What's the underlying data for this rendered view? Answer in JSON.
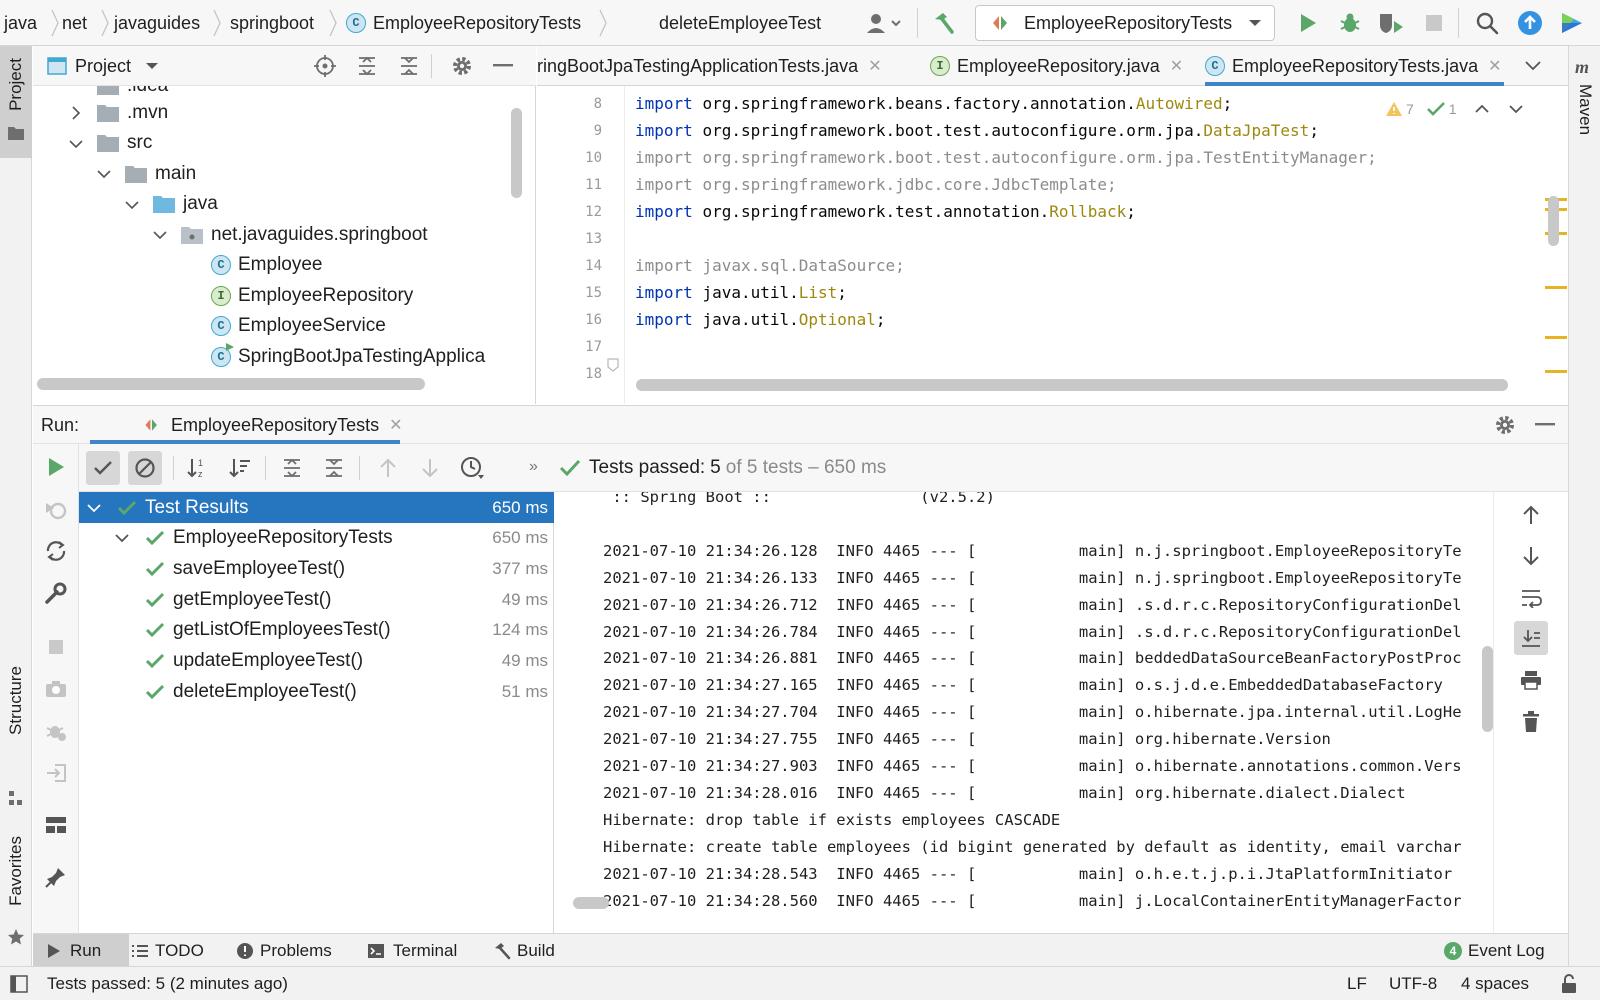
{
  "breadcrumbs": [
    "java",
    "net",
    "javaguides",
    "springboot",
    "EmployeeRepositoryTests",
    "deleteEmployeeTest"
  ],
  "run_config": "EmployeeRepositoryTests",
  "project_panel": {
    "title": "Project",
    "tree": [
      {
        "label": ".idea",
        "kind": "folder"
      },
      {
        "label": ".mvn",
        "kind": "folder"
      },
      {
        "label": "src",
        "kind": "folder"
      },
      {
        "label": "main",
        "kind": "folder"
      },
      {
        "label": "java",
        "kind": "source-folder"
      },
      {
        "label": "net.javaguides.springboot",
        "kind": "package"
      },
      {
        "label": "Employee",
        "kind": "class"
      },
      {
        "label": "EmployeeRepository",
        "kind": "interface"
      },
      {
        "label": "EmployeeService",
        "kind": "class"
      },
      {
        "label": "SpringBootJpaTestingApplica",
        "kind": "spring-class"
      }
    ]
  },
  "editor": {
    "tabs": [
      {
        "label": "ringBootJpaTestingApplicationTests.java",
        "icon": "C"
      },
      {
        "label": "EmployeeRepository.java",
        "icon": "I"
      },
      {
        "label": "EmployeeRepositoryTests.java",
        "icon": "C"
      }
    ],
    "inspections": {
      "warnings": "7",
      "ok": "1"
    },
    "lines": [
      {
        "n": "8",
        "kw": "import",
        "pkg": "org.springframework.beans.factory.annotation.",
        "cls": "Autowired",
        "end": ";",
        "used": true
      },
      {
        "n": "9",
        "kw": "import",
        "pkg": "org.springframework.boot.test.autoconfigure.orm.jpa.",
        "cls": "DataJpaTest",
        "end": ";",
        "used": true
      },
      {
        "n": "10",
        "kw": "import",
        "pkg": "org.springframework.boot.test.autoconfigure.orm.jpa.",
        "cls": "TestEntityManager",
        "end": ";",
        "used": false
      },
      {
        "n": "11",
        "kw": "import",
        "pkg": "org.springframework.jdbc.core.",
        "cls": "JdbcTemplate",
        "end": ";",
        "used": false
      },
      {
        "n": "12",
        "kw": "import",
        "pkg": "org.springframework.test.annotation.",
        "cls": "Rollback",
        "end": ";",
        "used": true
      },
      {
        "n": "13",
        "kw": "",
        "pkg": "",
        "cls": "",
        "end": "",
        "used": true
      },
      {
        "n": "14",
        "kw": "import",
        "pkg": "javax.sql.",
        "cls": "DataSource",
        "end": ";",
        "used": false
      },
      {
        "n": "15",
        "kw": "import",
        "pkg": "java.util.",
        "cls": "List",
        "end": ";",
        "used": true
      },
      {
        "n": "16",
        "kw": "import",
        "pkg": "java.util.",
        "cls": "Optional",
        "end": ";",
        "used": true
      },
      {
        "n": "17",
        "kw": "",
        "pkg": "",
        "cls": "",
        "end": "",
        "used": true
      },
      {
        "n": "18",
        "kw": "",
        "pkg": "",
        "cls": "",
        "end": "",
        "used": true
      }
    ]
  },
  "run": {
    "label": "Run:",
    "tab": "EmployeeRepositoryTests",
    "status_prefix": "Tests passed: ",
    "status_count": "5",
    "status_suffix": " of 5 tests – 650 ms",
    "tree": [
      {
        "label": "Test Results",
        "duration": "650 ms",
        "level": 0,
        "selected": true
      },
      {
        "label": "EmployeeRepositoryTests",
        "duration": "650 ms",
        "level": 1
      },
      {
        "label": "saveEmployeeTest()",
        "duration": "377 ms",
        "level": 2
      },
      {
        "label": "getEmployeeTest()",
        "duration": "49 ms",
        "level": 2
      },
      {
        "label": "getListOfEmployeesTest()",
        "duration": "124 ms",
        "level": 2
      },
      {
        "label": "updateEmployeeTest()",
        "duration": "49 ms",
        "level": 2
      },
      {
        "label": "deleteEmployeeTest()",
        "duration": "51 ms",
        "level": 2
      }
    ],
    "console": [
      " :: Spring Boot ::                (v2.5.2)",
      "",
      "2021-07-10 21:34:26.128  INFO 4465 --- [           main] n.j.springboot.EmployeeRepositoryTe",
      "2021-07-10 21:34:26.133  INFO 4465 --- [           main] n.j.springboot.EmployeeRepositoryTe",
      "2021-07-10 21:34:26.712  INFO 4465 --- [           main] .s.d.r.c.RepositoryConfigurationDel",
      "2021-07-10 21:34:26.784  INFO 4465 --- [           main] .s.d.r.c.RepositoryConfigurationDel",
      "2021-07-10 21:34:26.881  INFO 4465 --- [           main] beddedDataSourceBeanFactoryPostProc",
      "2021-07-10 21:34:27.165  INFO 4465 --- [           main] o.s.j.d.e.EmbeddedDatabaseFactory",
      "2021-07-10 21:34:27.704  INFO 4465 --- [           main] o.hibernate.jpa.internal.util.LogHe",
      "2021-07-10 21:34:27.755  INFO 4465 --- [           main] org.hibernate.Version",
      "2021-07-10 21:34:27.903  INFO 4465 --- [           main] o.hibernate.annotations.common.Vers",
      "2021-07-10 21:34:28.016  INFO 4465 --- [           main] org.hibernate.dialect.Dialect",
      "Hibernate: drop table if exists employees CASCADE",
      "Hibernate: create table employees (id bigint generated by default as identity, email varchar",
      "2021-07-10 21:34:28.543  INFO 4465 --- [           main] o.h.e.t.j.p.i.JtaPlatformInitiator",
      "2021-07-10 21:34:28.560  INFO 4465 --- [           main] j.LocalContainerEntityManagerFactor"
    ]
  },
  "side_labels": {
    "project": "Project",
    "structure": "Structure",
    "favorites": "Favorites",
    "maven": "Maven"
  },
  "bottom_tabs": [
    {
      "label": "Run",
      "icon": "play-icon"
    },
    {
      "label": "TODO",
      "icon": "list-icon"
    },
    {
      "label": "Problems",
      "icon": "info-icon"
    },
    {
      "label": "Terminal",
      "icon": "terminal-icon"
    },
    {
      "label": "Build",
      "icon": "hammer-icon"
    }
  ],
  "event_log": {
    "label": "Event Log",
    "count": "4"
  },
  "status": {
    "message": "Tests passed: 5 (2 minutes ago)",
    "line_sep": "LF",
    "encoding": "UTF-8",
    "indent": "4 spaces"
  },
  "colors": {
    "accent": "#2675bf",
    "selected_row": "#2675bf",
    "pass": "#59a869",
    "annotation": "#9e880d",
    "keyword": "#0033b3"
  }
}
